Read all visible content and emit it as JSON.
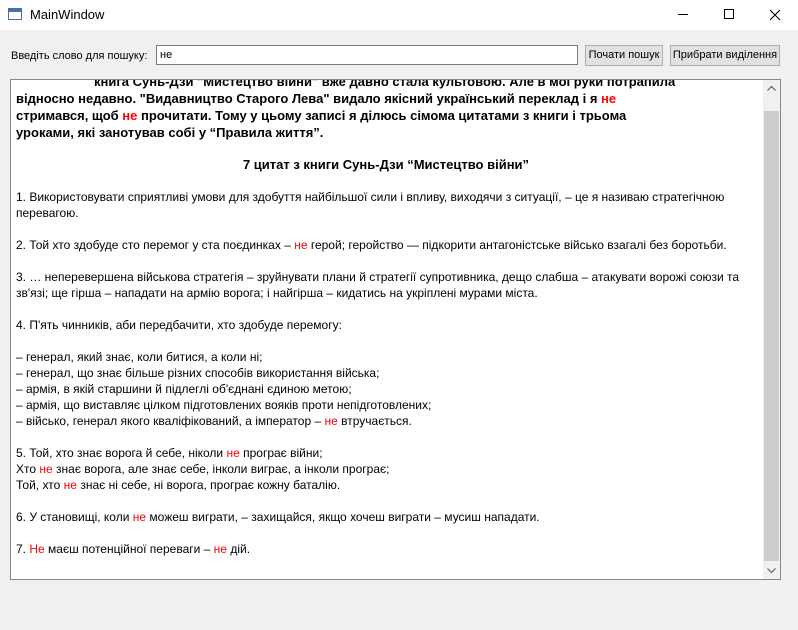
{
  "window": {
    "title": "MainWindow"
  },
  "search": {
    "label": "Введіть слово для пошуку:",
    "value": "не",
    "start_button": "Почати пошук",
    "clear_button": "Прибрати виділення"
  },
  "text": {
    "intro_line1": "книга Сунь-Дзи \"Мистецтво війни\" вже давно стала культовою. Але в мої руки потрапила",
    "intro_line2": "відносно недавно. \"Видавництво Старого Лева\" видало якісний український переклад і я ",
    "hl1": "не",
    "intro_line3a": "стримався, щоб ",
    "hl2": "не",
    "intro_line3b": " прочитати. Тому у цьому записі я ділюсь сімома цитатами з книги і трьома",
    "intro_line4": "уроками, які занотував собі у “Правила життя”.",
    "heading": "7 цитат з книги Сунь-Дзи “Мистецтво війни”",
    "q1": "1. Використовувати сприятливі умови для здобуття найбільшої сили і впливу, виходячи з ситуації, – це я називаю стратегічною перевагою.",
    "q2a": "2. Той хто здобуде сто перемог у ста поєдинках – ",
    "hl3": "не",
    "q2b": " герой; геройство — підкорити антагоністське військо взагалі без боротьби.",
    "q3": "3. … неперевершена військова стратегія – зруйнувати плани й стратегії супротивника, дещо слабша – атакувати ворожі союзи та зв'язі; ще гірша – нападати на армію ворога; і найгірша – кидатись на укріплені мурами міста.",
    "q4": "4. П'ять чинників, аби передбачити, хто здобуде перемогу:",
    "l1": "– генерал, який знає, коли битися, а коли ні;",
    "l2": "– генерал, що знає більше різних способів використання війська;",
    "l3": "– армія, в якій старшини й підлеглі об'єднані єдиною метою;",
    "l4": "– армія, що виставляє цілком підготовлених вояків проти непідготовлених;",
    "l5a": "– військо, генерал якого кваліфікований, а імператор – ",
    "hl4": "не",
    "l5b": " втручається.",
    "q5a1": "5. Той, хто знає ворога й себе, ніколи ",
    "hl5": "не",
    "q5a2": " програє війни;",
    "q5b1": "Хто ",
    "hl6": "не",
    "q5b2": " знає ворога, але знає себе, інколи виграє, а інколи програє;",
    "q5c1": "Той, хто ",
    "hl7": "не",
    "q5c2": " знає ні себе, ні ворога, програє кожну баталію.",
    "q6a": "6. У становищі, коли ",
    "hl8": "не",
    "q6b": " можеш виграти, – захищайся, якщо хочеш виграти – мусиш нападати.",
    "q7a": "7. ",
    "hl9": "Не",
    "q7b": " маєш потенційної переваги – ",
    "hl10": "не",
    "q7c": " дій."
  },
  "colors": {
    "highlight": "#ff0000",
    "window_bg": "#f0f0f0"
  },
  "icons": [
    "app-icon",
    "minimize-icon",
    "maximize-icon",
    "close-icon",
    "scroll-up-arrow-icon",
    "scroll-down-arrow-icon"
  ]
}
